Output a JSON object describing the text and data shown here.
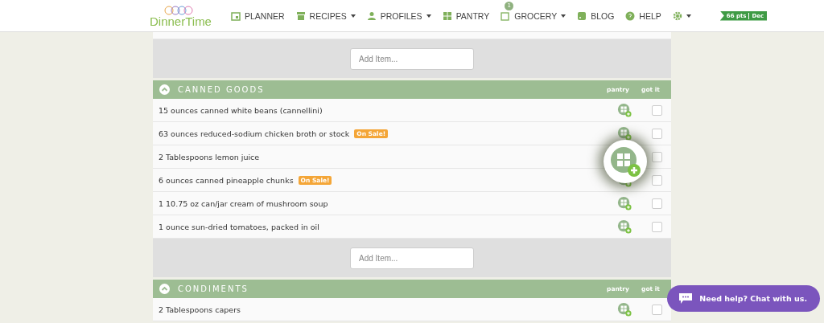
{
  "logo": "DinnerTime",
  "nav": [
    {
      "label": "PLANNER",
      "kind": "calendar",
      "caret": false
    },
    {
      "label": "RECIPES",
      "kind": "box",
      "caret": true
    },
    {
      "label": "PROFILES",
      "kind": "user",
      "caret": true
    },
    {
      "label": "PANTRY",
      "kind": "grid",
      "caret": false
    },
    {
      "label": "GROCERY",
      "kind": "grocery",
      "caret": true,
      "badge": "1"
    },
    {
      "label": "BLOG",
      "kind": "rss",
      "caret": false
    },
    {
      "label": "HELP",
      "kind": "help",
      "caret": false
    }
  ],
  "settings": {
    "caret": true
  },
  "points": {
    "value": "66 pts",
    "period": "Dec"
  },
  "previous_section_add_item": {
    "placeholder": "Add Item..."
  },
  "sections": [
    {
      "title": "CANNED GOODS",
      "pantry_label": "pantry",
      "got_it_label": "got it",
      "add_item": {
        "placeholder": "Add Item..."
      },
      "items": [
        {
          "text": "15 ounces canned white beans (cannellini)",
          "checked": false
        },
        {
          "text": "63 ounces reduced-sodium chicken broth or stock",
          "sale_tag": "On Sale!",
          "checked": false
        },
        {
          "text": "2 Tablespoons lemon juice",
          "checked": false
        },
        {
          "text": "6 ounces canned pineapple chunks",
          "sale_tag": "On Sale!",
          "checked": false
        },
        {
          "text": "1 10.75 oz can/jar cream of mushroom soup",
          "checked": false
        },
        {
          "text": "1 ounce sun-dried tomatoes, packed in oil",
          "checked": false
        }
      ]
    },
    {
      "title": "CONDIMENTS",
      "pantry_label": "pantry",
      "got_it_label": "got it",
      "items": [
        {
          "text": "2 Tablespoons capers",
          "checked": false
        }
      ]
    }
  ],
  "chat": {
    "label": "Need help? Chat with us."
  }
}
